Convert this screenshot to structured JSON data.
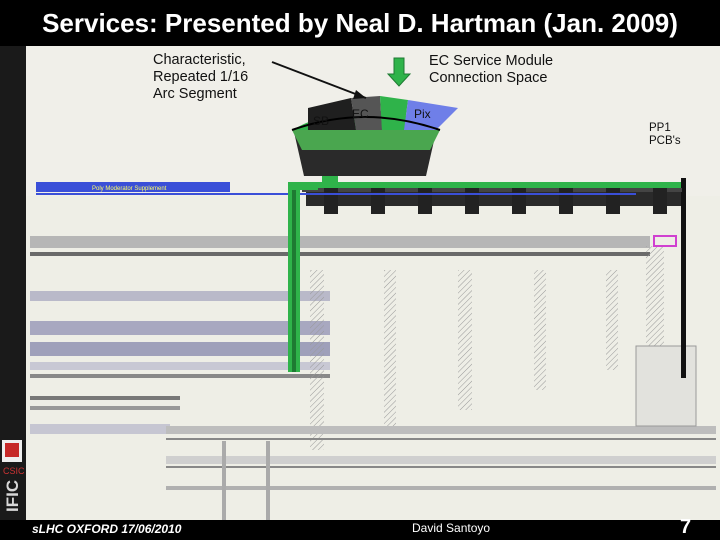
{
  "title": "Services: Presented by Neal D. Hartman (Jan. 2009)",
  "labels": {
    "characteristic": "Characteristic,\nRepeated 1/16\nArc Segment",
    "ec_service": "EC Service Module\nConnection Space",
    "pp1": "PP1\nPCB's",
    "sb": "SB",
    "ec": "EC",
    "pix": "Pix",
    "poly_moderator": "Poly Moderator Supplement"
  },
  "logo": {
    "ific": "IFIC",
    "csic": "CSIC"
  },
  "footer": {
    "left": "sLHC OXFORD 17/06/2010",
    "center": "David Santoyo",
    "page": "7"
  },
  "colors": {
    "background": "#000000",
    "panel": "#f0efe9",
    "green": "#2fb34a",
    "blue": "#3a4fd8",
    "dark": "#2a2a2a"
  }
}
